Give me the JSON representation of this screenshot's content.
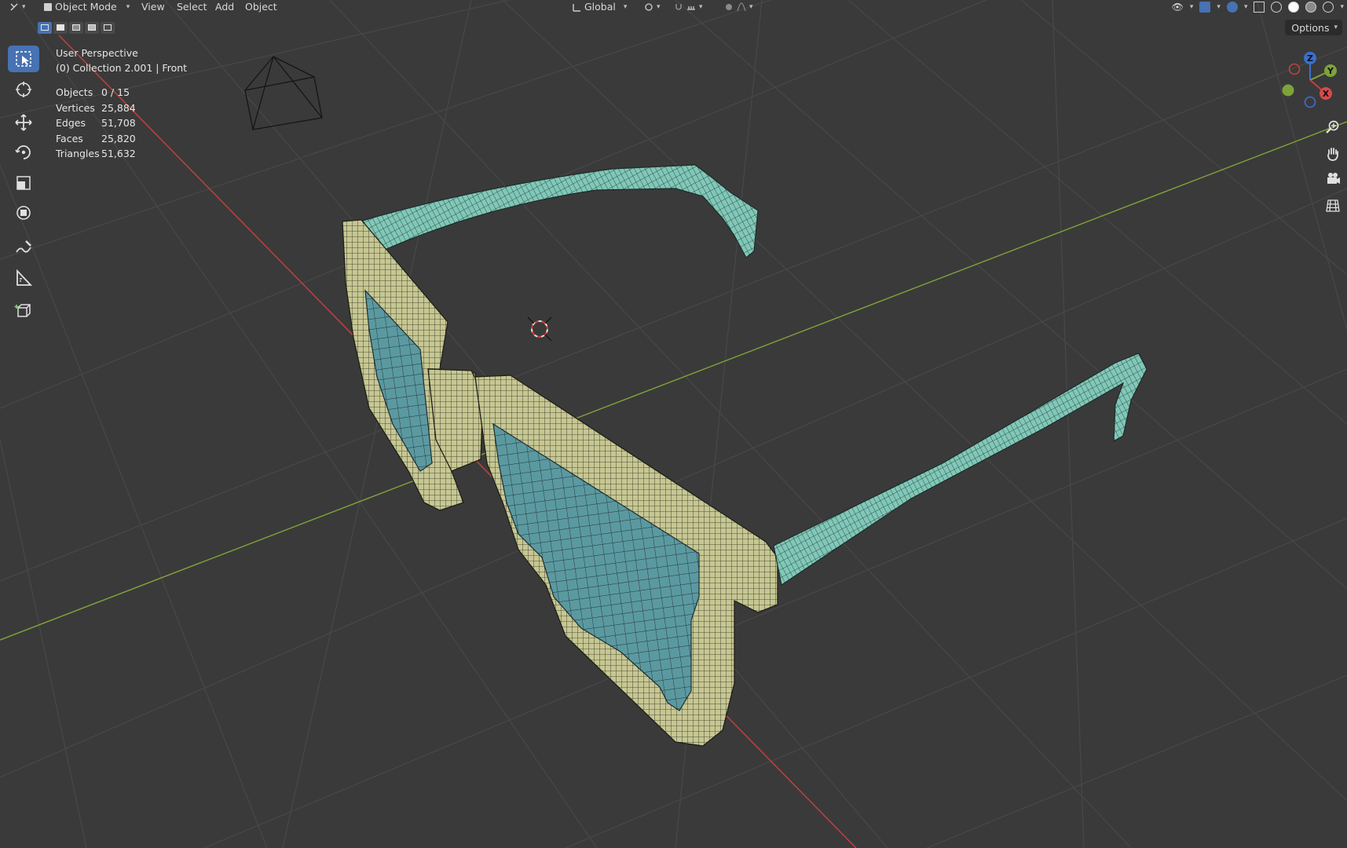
{
  "header": {
    "mode_label": "Object Mode",
    "menus": [
      "View",
      "Select",
      "Add",
      "Object"
    ],
    "transform_orientation": "Global"
  },
  "overlay": {
    "perspective": "User Perspective",
    "collection": "(0) Collection 2.001 | Front"
  },
  "stats": [
    {
      "label": "Objects",
      "value": "0 / 15"
    },
    {
      "label": "Vertices",
      "value": "25,884"
    },
    {
      "label": "Edges",
      "value": "51,708"
    },
    {
      "label": "Faces",
      "value": "25,820"
    },
    {
      "label": "Triangles",
      "value": "51,632"
    }
  ],
  "options_label": "Options",
  "gizmo": {
    "x": "X",
    "y": "Y",
    "z": "Z"
  },
  "icons": {
    "toolbar": [
      "select-box-icon",
      "cursor-icon",
      "move-icon",
      "rotate-icon",
      "scale-icon",
      "transform-icon",
      "annotate-icon",
      "measure-icon",
      "add-cube-icon"
    ],
    "nav": [
      "zoom-icon",
      "pan-hand-icon",
      "camera-view-icon",
      "ortho-grid-icon"
    ]
  },
  "colors": {
    "viewport_bg": "#3a3a3a",
    "grid": "#474747",
    "x_axis": "#c0413f",
    "y_axis": "#7ea23a",
    "active_tool": "#4772b3",
    "frame_wire": "#c9c98e",
    "lens_wire": "#5f9ea2",
    "temple_wire": "#7fc7b9"
  }
}
